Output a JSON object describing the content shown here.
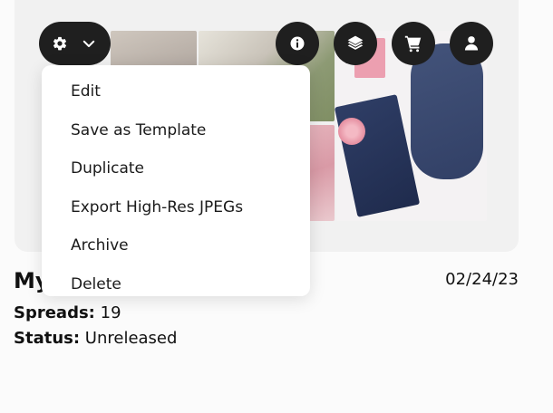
{
  "card": {
    "date": "02/24/23",
    "title_visible": "My"
  },
  "toolbar": {
    "settings_icon": "gear-icon",
    "chevron_icon": "chevron-down-icon",
    "info_icon": "info-icon",
    "layers_icon": "layers-icon",
    "cart_icon": "cart-icon",
    "user_icon": "user-icon"
  },
  "menu": {
    "items": [
      {
        "label": "Edit"
      },
      {
        "label": "Save as Template"
      },
      {
        "label": "Duplicate"
      },
      {
        "label": "Export High-Res JPEGs"
      },
      {
        "label": "Archive"
      },
      {
        "label": "Delete"
      }
    ]
  },
  "details": {
    "spreads_label": "Spreads:",
    "spreads_value": "19",
    "status_label": "Status:",
    "status_value": "Unreleased"
  }
}
